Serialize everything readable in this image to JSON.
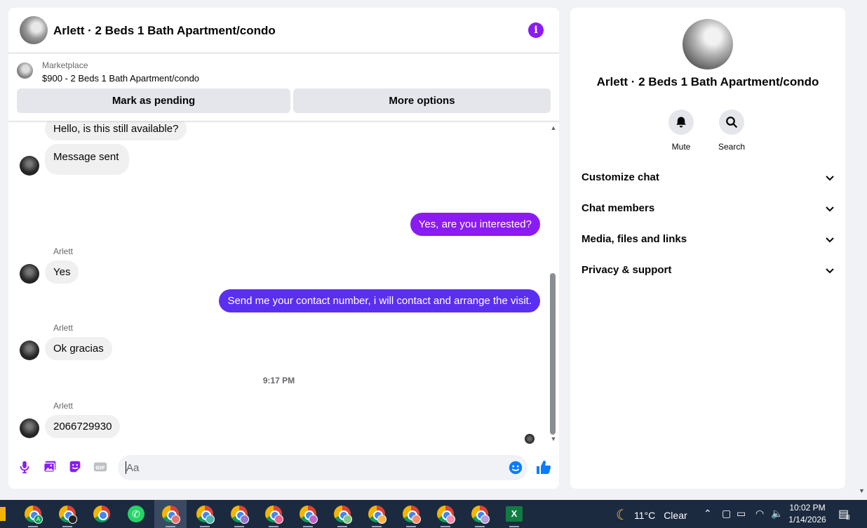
{
  "chat": {
    "title": "Arlett · 2 Beds 1 Bath Apartment/condo",
    "info_icon": "info-icon",
    "marketplace": {
      "label": "Marketplace",
      "item": "$900 - 2 Beds 1 Bath Apartment/condo",
      "mark_pending": "Mark as pending",
      "more_options": "More options"
    },
    "messages": [
      {
        "text": "Hello, is this still available?"
      },
      {
        "text": "Message sent"
      },
      {
        "text": "Yes, are you interested?",
        "color": "#8a1bf2"
      },
      {
        "sender": "Arlett",
        "text": "Yes"
      },
      {
        "text": "Send me your contact number, i will contact and arrange the visit.",
        "color": "#5b2ff0"
      },
      {
        "sender": "Arlett",
        "text": "Ok gracias"
      },
      {
        "time": "9:17 PM"
      },
      {
        "sender": "Arlett",
        "text": "2066729930"
      }
    ],
    "composer": {
      "placeholder": "Aa",
      "icons": [
        "microphone-icon",
        "photo-icon",
        "sticker-icon",
        "gif-icon",
        "emoji-icon",
        "thumbs-up-icon"
      ]
    }
  },
  "info_panel": {
    "title": "Arlett · 2 Beds 1 Bath Apartment/condo",
    "actions": [
      {
        "label": "Mute",
        "icon": "bell-icon"
      },
      {
        "label": "Search",
        "icon": "search-icon"
      }
    ],
    "sections": [
      {
        "label": "Customize chat"
      },
      {
        "label": "Chat members"
      },
      {
        "label": "Media, files and links"
      },
      {
        "label": "Privacy & support"
      }
    ]
  },
  "taskbar": {
    "apps": [
      "chrome",
      "chrome",
      "chrome",
      "whatsapp",
      "chrome",
      "chrome",
      "chrome",
      "chrome",
      "chrome",
      "chrome",
      "chrome",
      "chrome",
      "chrome",
      "chrome",
      "excel"
    ],
    "weather": {
      "temp": "11°C",
      "condition": "Clear"
    },
    "time": "10:02 PM",
    "date": "1/14/2026",
    "notifications": "8"
  },
  "colors": {
    "accent": "#8a1bf2",
    "outgoing_bubble": "#5b2ff0",
    "incoming_bubble": "#f0f0f0",
    "taskbar": "#1c2a3f"
  }
}
